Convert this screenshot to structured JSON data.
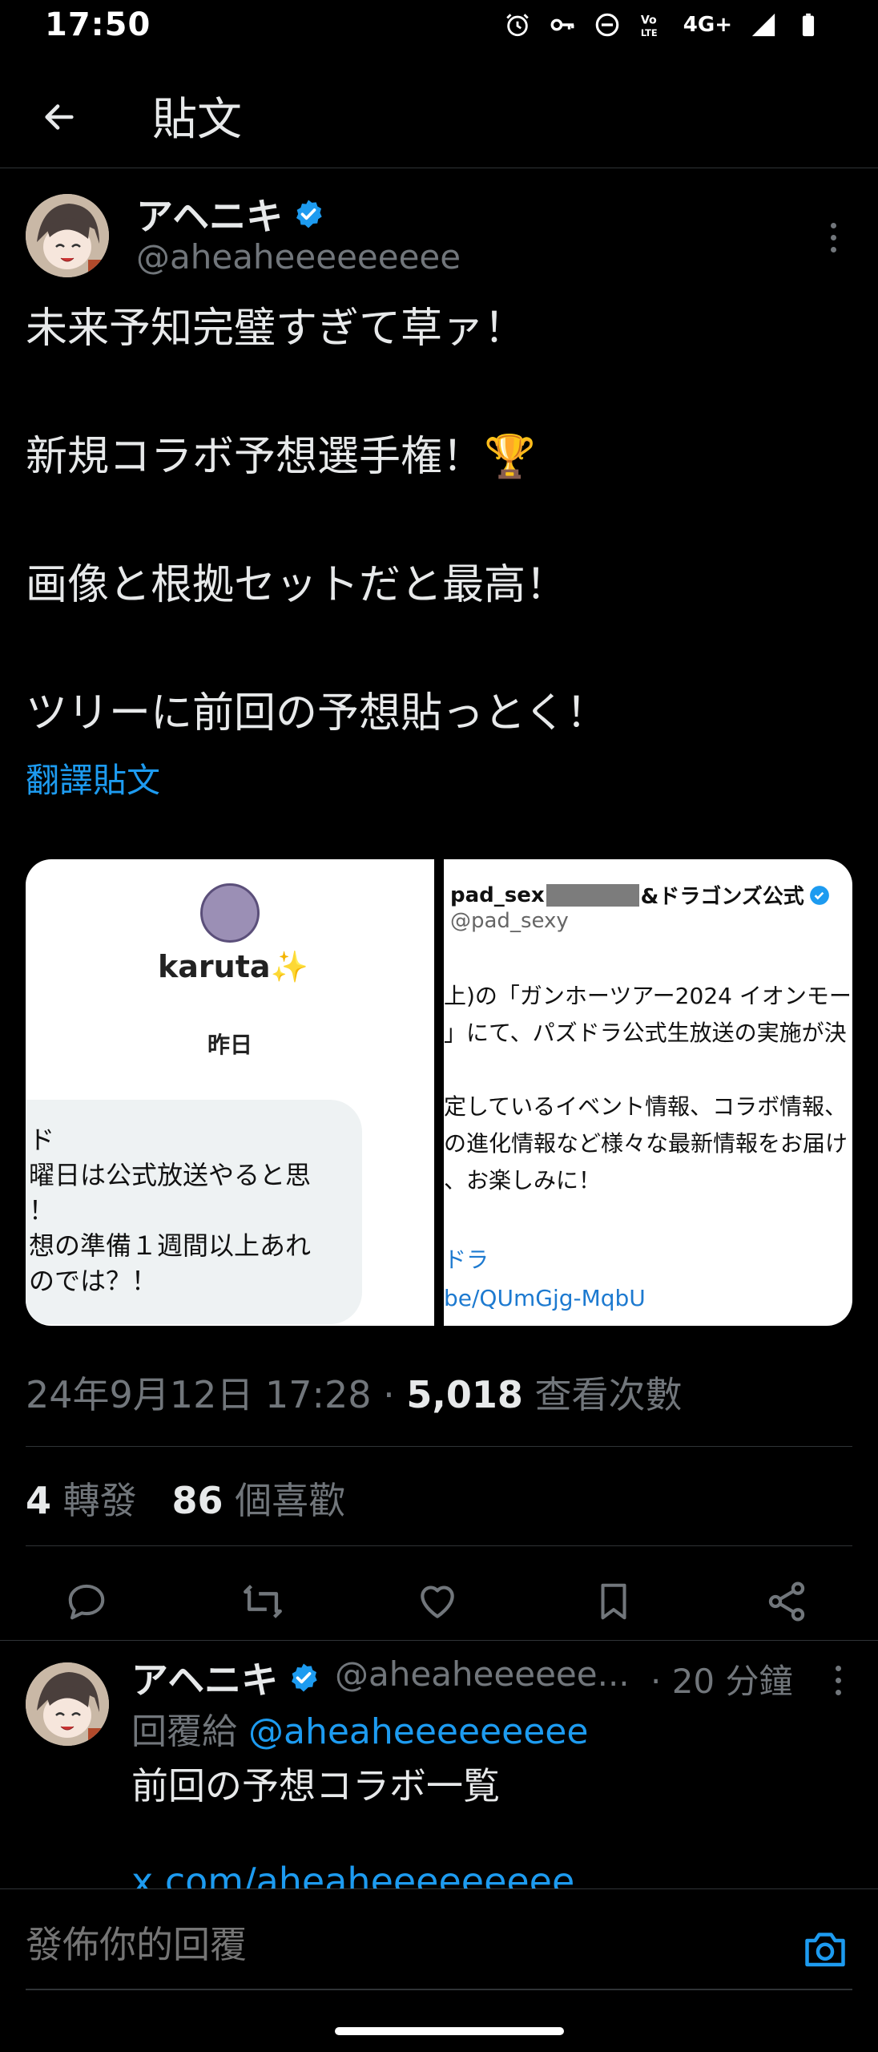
{
  "status_bar": {
    "time": "17:50",
    "network": "4G+",
    "icons": [
      "alarm-icon",
      "vpn-key-icon",
      "dnd-icon",
      "volte-icon",
      "signal-icon",
      "battery-icon"
    ]
  },
  "header": {
    "title": "貼文",
    "back_icon": "arrow-left-icon"
  },
  "post": {
    "author_name": "アヘニキ",
    "author_handle": "@aheaheeeeeeeee",
    "verified": true,
    "lines": [
      "未来予知完璧すぎて草ァ！",
      "",
      "新規コラボ予想選手権！🏆",
      "",
      "画像と根拠セットだと最高！",
      "",
      "ツリーに前回の予想貼っとく！"
    ],
    "translate_label": "翻譯貼文",
    "media": {
      "left": {
        "name": "karuta✨",
        "day": "昨日",
        "bubble_lines": [
          "ド",
          "曜日は公式放送やると思",
          "！",
          "想の準備１週間以上あれ",
          "のでは？！"
        ]
      },
      "right": {
        "name_prefix": "pad_sex",
        "name_suffix": "&ドラゴンズ公式",
        "handle": "@pad_sexy",
        "body_lines": [
          "上)の「ガンホーツアー2024 イオンモー",
          "」にて、パズドラ公式生放送の実施が決",
          "",
          "定しているイベント情報、コラボ情報、",
          "の進化情報など様々な最新情報をお届け",
          "、お楽しみに！"
        ],
        "link_lines": [
          "ドラ",
          "be/QUmGjg-MqbU"
        ]
      }
    },
    "timestamp": "24年9月12日 17:28",
    "separator": " · ",
    "views_count": "5,018",
    "views_label": "查看次數",
    "retweets_count": "4",
    "retweets_label": "轉發",
    "likes_count": "86",
    "likes_label": "個喜歡"
  },
  "reply": {
    "author_name": "アヘニキ",
    "author_handle": "@aheaheeeeee...",
    "time": "· 20 分鐘",
    "reply_to_prefix": "回覆給 ",
    "reply_to_handle": "@aheaheeeeeeeee",
    "text": "前回の予想コラボ一覧",
    "link": "x.com/aheaheeeeeeeee"
  },
  "composer": {
    "placeholder": "發佈你的回覆"
  },
  "colors": {
    "background": "#000000",
    "text": "#e7e9ea",
    "secondary": "#71767b",
    "accent": "#1d9bf0"
  }
}
